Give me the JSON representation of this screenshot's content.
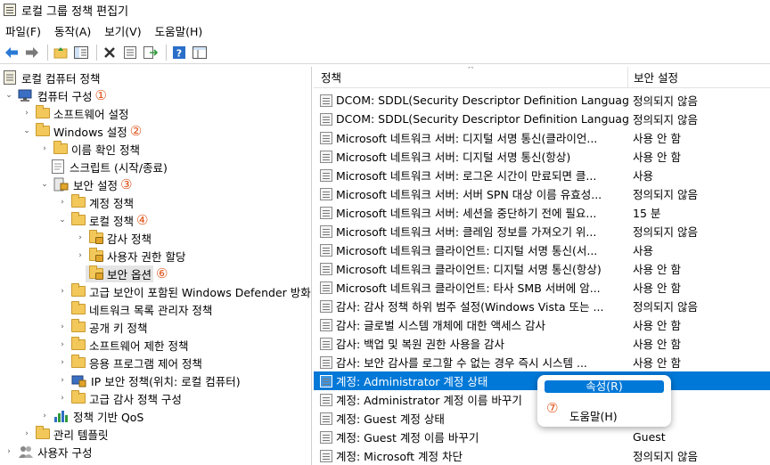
{
  "window": {
    "title": "로컬 그룹 정책 편집기"
  },
  "menu": [
    "파일(F)",
    "동작(A)",
    "보기(V)",
    "도움말(H)"
  ],
  "toolbar": [
    "back-icon",
    "forward-icon",
    "up-folder-icon",
    "show-hide-tree-icon",
    "delete-icon",
    "properties-icon",
    "export-icon",
    "help-icon",
    "view-icon"
  ],
  "tree": {
    "root": "로컬 컴퓨터 정책",
    "computer": "컴퓨터 구성",
    "computer_num": "①",
    "software_settings": "소프트웨어 설정",
    "windows_settings": "Windows 설정",
    "windows_settings_num": "②",
    "name_resolution": "이름 확인 정책",
    "scripts": "스크립트 (시작/종료)",
    "security_settings": "보안 설정",
    "security_settings_num": "③",
    "account_policies": "계정 정책",
    "local_policies": "로컬 정책",
    "local_policies_num": "④",
    "audit_policy": "감사 정책",
    "user_rights": "사용자 권한 할당",
    "security_options": "보안 옵션",
    "security_options_num": "⑥",
    "defender_firewall": "고급 보안이 포함된 Windows Defender 방화벽",
    "network_list": "네트워크 목록 관리자 정책",
    "public_key": "공개 키 정책",
    "software_restriction": "소프트웨어 제한 정책",
    "app_control": "응용 프로그램 제어 정책",
    "ip_security": "IP 보안 정책(위치: 로컬 컴퓨터)",
    "advanced_audit": "고급 감사 정책 구성",
    "qos": "정책 기반 QoS",
    "admin_templates": "관리 템플릿",
    "user_config": "사용자 구성"
  },
  "list": {
    "col_policy": "정책",
    "col_setting": "보안 설정",
    "rows": [
      {
        "name": "DCOM: SDDL(Security Descriptor Definition Languag...",
        "value": "정의되지 않음"
      },
      {
        "name": "DCOM: SDDL(Security Descriptor Definition Languag...",
        "value": "정의되지 않음"
      },
      {
        "name": "Microsoft 네트워크 서버: 디지털 서명 통신(클라이언...",
        "value": "사용 안 함"
      },
      {
        "name": "Microsoft 네트워크 서버: 디지털 서명 통신(항상)",
        "value": "사용 안 함"
      },
      {
        "name": "Microsoft 네트워크 서버: 로그온 시간이 만료되면 클...",
        "value": "사용"
      },
      {
        "name": "Microsoft 네트워크 서버: 서버 SPN 대상 이름 유효성...",
        "value": "정의되지 않음"
      },
      {
        "name": "Microsoft 네트워크 서버: 세션을 중단하기 전에 필요...",
        "value": "15 분"
      },
      {
        "name": "Microsoft 네트워크 서버: 클레임 정보를 가져오기 위...",
        "value": "정의되지 않음"
      },
      {
        "name": "Microsoft 네트워크 클라이언트: 디지털 서명 통신(서...",
        "value": "사용"
      },
      {
        "name": "Microsoft 네트워크 클라이언트: 디지털 서명 통신(항상)",
        "value": "사용 안 함"
      },
      {
        "name": "Microsoft 네트워크 클라이언트: 타사 SMB 서버에 암...",
        "value": "사용 안 함"
      },
      {
        "name": "감사: 감사 정책 하위 범주 설정(Windows Vista 또는 ...",
        "value": "정의되지 않음"
      },
      {
        "name": "감사: 글로벌 시스템 개체에 대한 액세스 감사",
        "value": "사용 안 함"
      },
      {
        "name": "감사: 백업 및 복원 권한 사용을 감사",
        "value": "사용 안 함"
      },
      {
        "name": "감사: 보안 감사를 로그할 수 없는 경우 즉시 시스템 ...",
        "value": "사용 안 함"
      },
      {
        "name": "계정: Administrator 계정 상태",
        "value": ""
      },
      {
        "name": "계정: Administrator 계정 이름 바꾸기",
        "value": "strator"
      },
      {
        "name": "계정: Guest 계정 상태",
        "value": "함"
      },
      {
        "name": "계정: Guest 계정 이름 바꾸기",
        "value": "Guest"
      },
      {
        "name": "계정: Microsoft 계정 차단",
        "value": "정의되지 않음"
      }
    ]
  },
  "context_menu": {
    "properties": "속성(R)",
    "help": "도움말(H)",
    "num": "⑦"
  },
  "colors": {
    "selection": "#0078d7",
    "annotation": "#e0561e",
    "folder": "#f3c85a"
  }
}
